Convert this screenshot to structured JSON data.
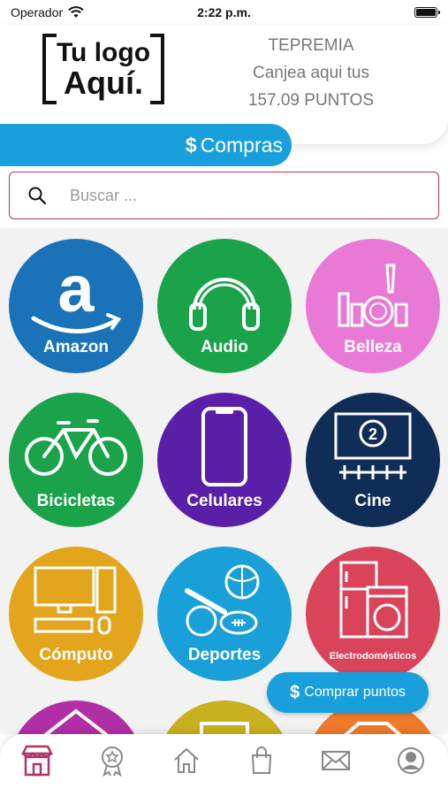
{
  "status_bar": {
    "carrier": "Operador",
    "time": "2:22 p.m."
  },
  "logo": {
    "line1": "Tu logo",
    "line2": "Aquí."
  },
  "points": {
    "program": "TEPREMIA",
    "line2": "Canjea aqui tus",
    "line3": "157.09 PUNTOS"
  },
  "compras_tab": {
    "symbol": "$",
    "label": "Compras"
  },
  "search": {
    "placeholder": "Buscar ..."
  },
  "categories": [
    {
      "label": "Amazon",
      "color": "#1a73b8",
      "icon": "amazon-icon"
    },
    {
      "label": "Audio",
      "color": "#1aa34a",
      "icon": "headphones-icon"
    },
    {
      "label": "Belleza",
      "color": "#e87ad6",
      "icon": "makeup-icon"
    },
    {
      "label": "Bicicletas",
      "color": "#1aa34a",
      "icon": "bicycle-icon"
    },
    {
      "label": "Celulares",
      "color": "#5a1fa8",
      "icon": "phone-icon"
    },
    {
      "label": "Cine",
      "color": "#0f2d56",
      "icon": "cinema-icon"
    },
    {
      "label": "Cómputo",
      "color": "#e3a51c",
      "icon": "computer-icon"
    },
    {
      "label": "Deportes",
      "color": "#1aa0d8",
      "icon": "sports-icon"
    },
    {
      "label": "Electrodomésticos",
      "color": "#d9445a",
      "icon": "appliances-icon"
    }
  ],
  "float_button": {
    "symbol": "$",
    "label": "Comprar puntos"
  },
  "bottom_nav": [
    {
      "icon": "store-icon",
      "active": true
    },
    {
      "icon": "medal-icon"
    },
    {
      "icon": "home-icon"
    },
    {
      "icon": "shopping-bag-icon"
    },
    {
      "icon": "mail-icon"
    },
    {
      "icon": "profile-icon"
    }
  ],
  "colors": {
    "accent": "#1a9fdd",
    "active_nav": "#b0336a"
  }
}
